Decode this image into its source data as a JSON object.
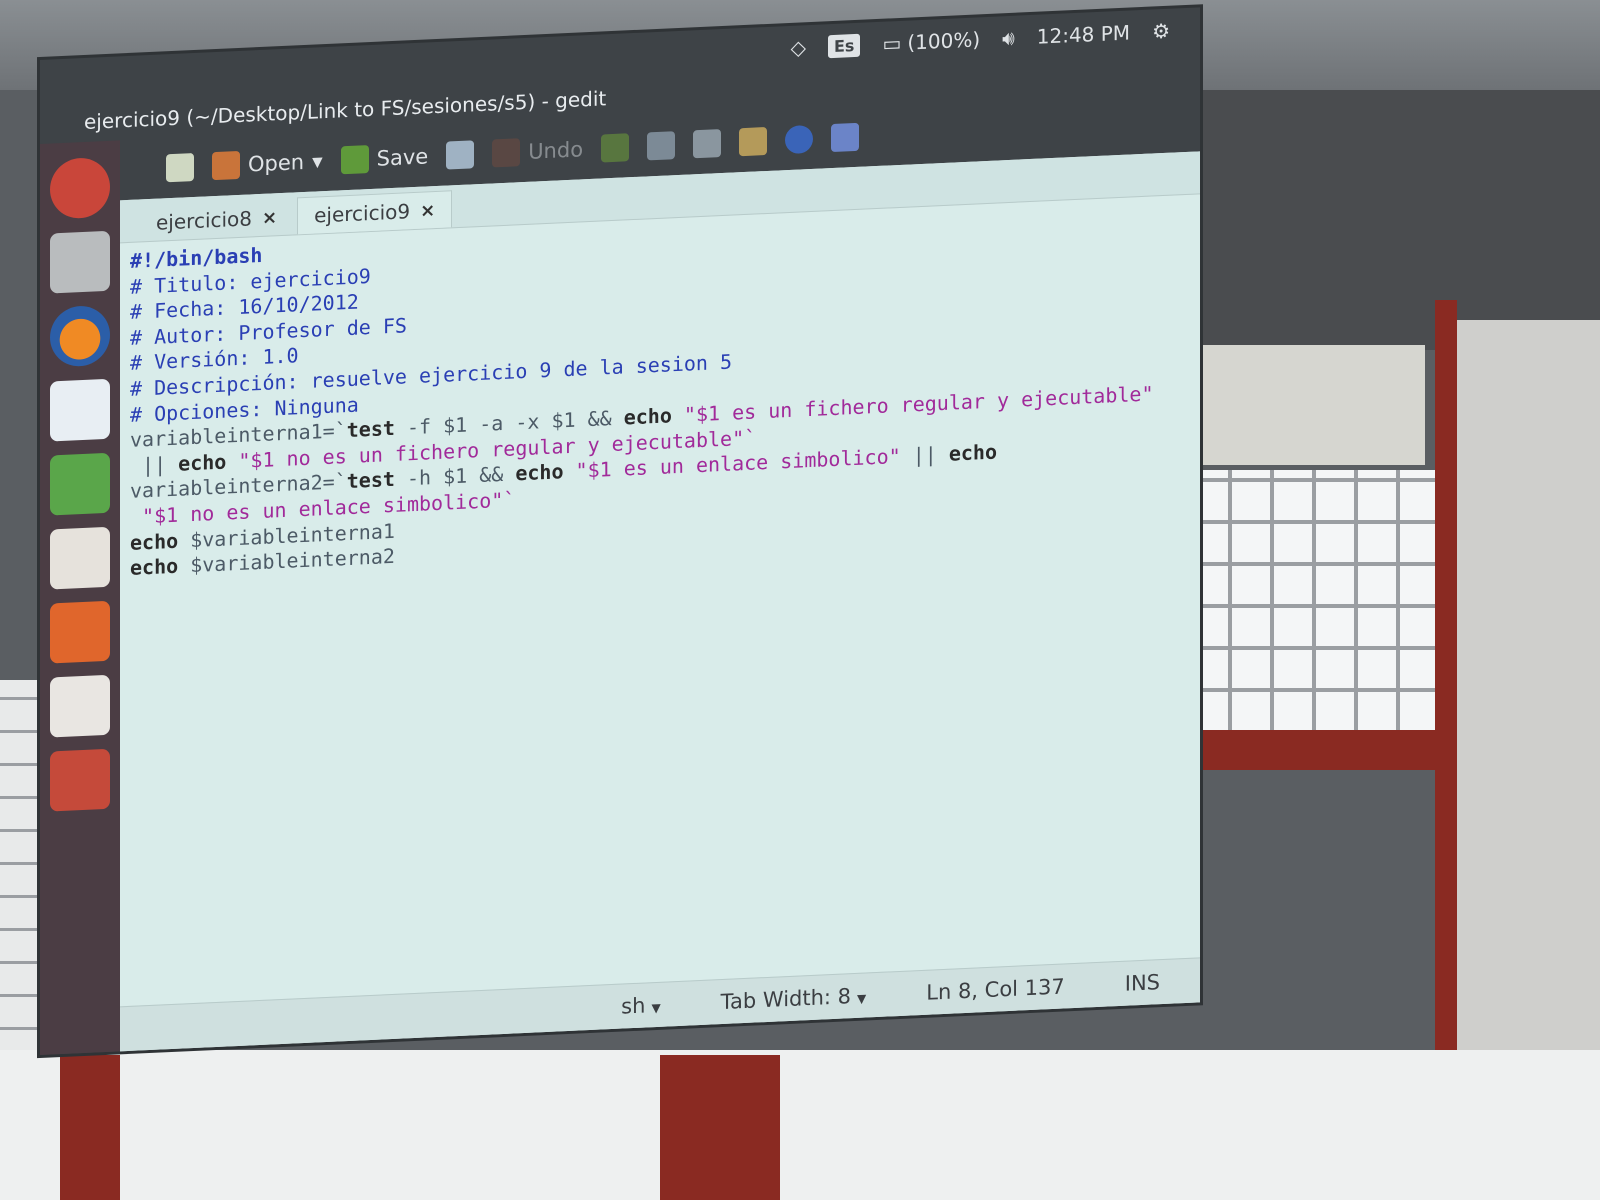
{
  "topbar": {
    "keyboard_layout": "Es",
    "battery": "(100%)",
    "time": "12:48 PM",
    "icons": [
      "wifi-icon",
      "battery-icon",
      "volume-icon",
      "gear-icon"
    ]
  },
  "window": {
    "title": "ejercicio9 (~/Desktop/Link to FS/sesiones/s5) - gedit"
  },
  "toolbar": {
    "open_label": "Open",
    "save_label": "Save",
    "undo_label": "Undo"
  },
  "launcher": {
    "items": [
      "ubuntu-dash",
      "files",
      "firefox",
      "libreoffice-writer",
      "libreoffice-calc",
      "libreoffice-impress",
      "software-center",
      "amazon",
      "trash"
    ]
  },
  "tabs": [
    {
      "label": "ejercicio8",
      "close": "×"
    },
    {
      "label": "ejercicio9",
      "close": "×"
    }
  ],
  "code": {
    "l1": "#!/bin/bash",
    "l2": "# Titulo: ejercicio9",
    "l3": "# Fecha: 16/10/2012",
    "l4": "# Autor: Profesor de FS",
    "l5": "# Versión: 1.0",
    "l6": "# Descripción: resuelve ejercicio 9 de la sesion 5",
    "l7": "# Opciones: Ninguna",
    "l8a": "variableinterna1=`",
    "l8b": "test",
    "l8c": " -f $1 -a -x $1 && ",
    "l8d": "echo",
    "l8e": " \"$1 es un fichero regular y ejecutable\"",
    "l8f": " || ",
    "l8g": "echo",
    "l8h": " \"$1 no es un fichero regular y ejecutable\"`",
    "l9a": "variableinterna2=`",
    "l9b": "test",
    "l9c": " -h $1 && ",
    "l9d": "echo",
    "l9e": " \"$1 es un enlace simbolico\"",
    "l9f": " || ",
    "l9g": "echo",
    "l9h": " \"$1 no es un enlace simbolico\"`",
    "l10a": "echo",
    "l10b": " $variableinterna1",
    "l11a": "echo",
    "l11b": " $variableinterna2"
  },
  "statusbar": {
    "language": "sh",
    "tab_width": "Tab Width: 8",
    "position": "Ln 8, Col 137",
    "mode": "INS"
  }
}
